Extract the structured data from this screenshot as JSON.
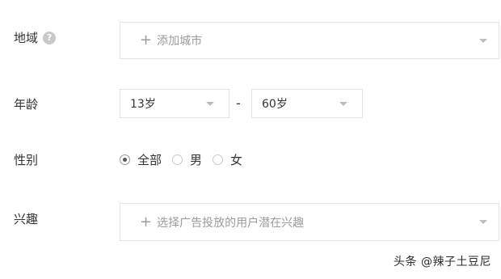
{
  "region": {
    "label": "地域",
    "help_icon": "help-circle-icon",
    "plus": "+",
    "placeholder": "添加城市"
  },
  "age": {
    "label": "年龄",
    "min": "13岁",
    "separator": "-",
    "max": "60岁"
  },
  "gender": {
    "label": "性别",
    "options": [
      {
        "label": "全部",
        "checked": true
      },
      {
        "label": "男",
        "checked": false
      },
      {
        "label": "女",
        "checked": false
      }
    ]
  },
  "interest": {
    "label": "兴趣",
    "plus": "+",
    "placeholder": "选择广告投放的用户潜在兴趣"
  },
  "watermark": "头条 @辣子土豆尼",
  "colors": {
    "border": "#e3e3e3",
    "placeholder": "#9b9b9b",
    "text": "#333333"
  }
}
